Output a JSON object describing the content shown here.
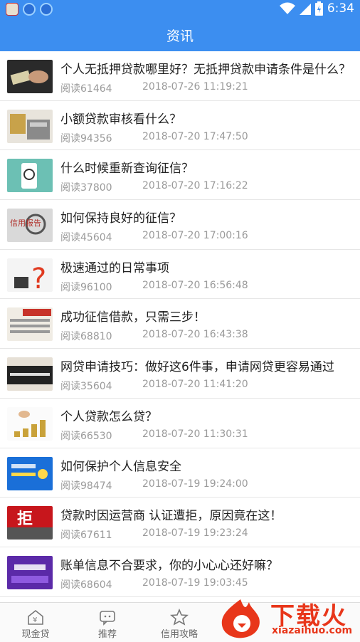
{
  "status_bar": {
    "time": "6:34"
  },
  "header": {
    "title": "资讯"
  },
  "articles": [
    {
      "title": "个人无抵押贷款哪里好？无抵押贷款申请条件是什么？",
      "reads": "阅读61464",
      "date": "2018-07-26 11:19:21"
    },
    {
      "title": "小额贷款审核看什么？",
      "reads": "阅读94356",
      "date": "2018-07-20 17:47:50"
    },
    {
      "title": "什么时候重新查询征信？",
      "reads": "阅读37800",
      "date": "2018-07-20 17:16:22"
    },
    {
      "title": "如何保持良好的征信？",
      "reads": "阅读45604",
      "date": "2018-07-20 17:00:16"
    },
    {
      "title": "极速通过的日常事项",
      "reads": "阅读96100",
      "date": "2018-07-20 16:56:48"
    },
    {
      "title": "成功征信借款，只需三步！",
      "reads": "阅读68810",
      "date": "2018-07-20 16:43:38"
    },
    {
      "title": "网贷申请技巧：做好这6件事，申请网贷更容易通过",
      "reads": "阅读35604",
      "date": "2018-07-20 11:41:20"
    },
    {
      "title": "个人贷款怎么贷？",
      "reads": "阅读66530",
      "date": "2018-07-20 11:30:31"
    },
    {
      "title": "如何保护个人信息安全",
      "reads": "阅读98474",
      "date": "2018-07-19 19:24:00"
    },
    {
      "title": "贷款时因运营商 认证遭拒，原因竟在这！",
      "reads": "阅读67611",
      "date": "2018-07-19 19:23:24"
    },
    {
      "title": "账单信息不合要求，你的小心心还好嘛？",
      "reads": "阅读68604",
      "date": "2018-07-19 19:03:45"
    }
  ],
  "thumb_texts": {
    "credit_report": "信用报告",
    "reject": "拒"
  },
  "tabs": [
    {
      "label": "现金贷",
      "icon": "home-yen-icon"
    },
    {
      "label": "推荐",
      "icon": "chat-icon"
    },
    {
      "label": "信用攻略",
      "icon": "star-icon"
    }
  ],
  "watermark": {
    "text": "下载火",
    "url": "xiazaihuo.com"
  },
  "colors": {
    "primary": "#3c8ef0",
    "watermark": "#e8361a"
  }
}
